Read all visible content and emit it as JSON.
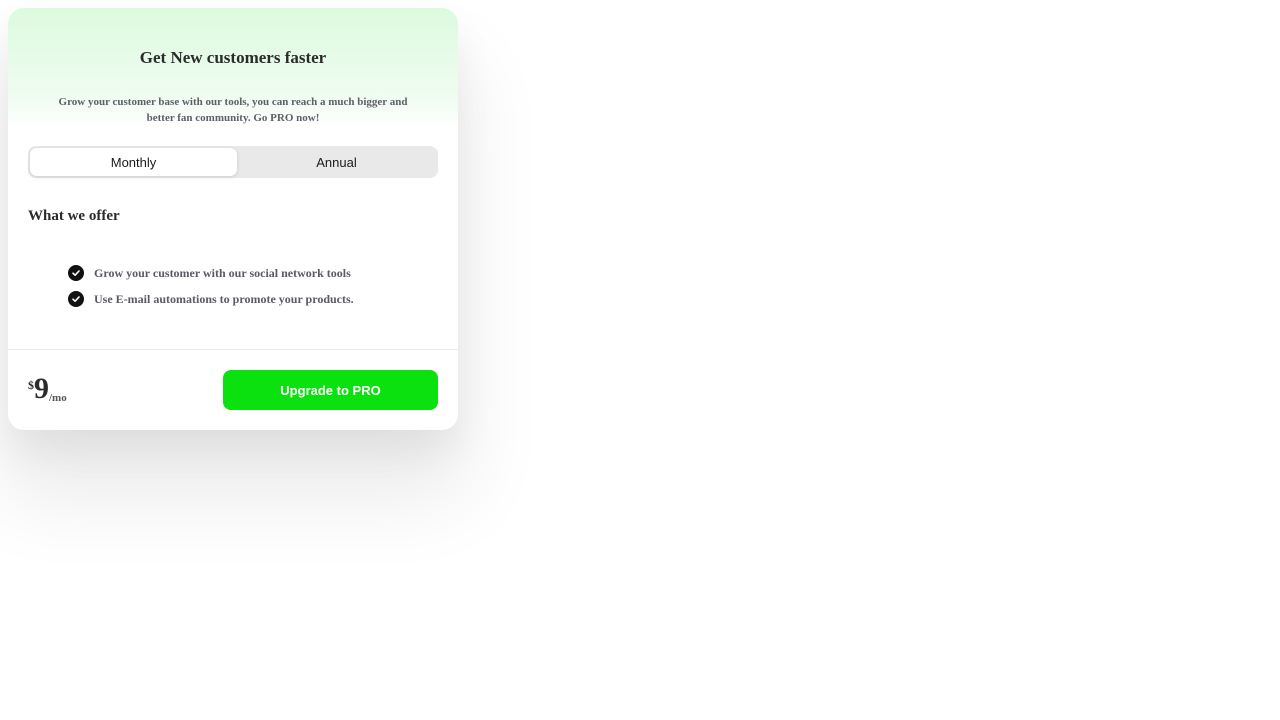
{
  "card": {
    "title": "Get New customers faster",
    "subtitle": "Grow your customer base with our tools, you can reach a much bigger and better fan community. Go PRO now!"
  },
  "billing_toggle": {
    "options": [
      {
        "label": "Monthly",
        "selected": true
      },
      {
        "label": "Annual",
        "selected": false
      }
    ]
  },
  "offer": {
    "title": "What we offer",
    "features": [
      {
        "icon": "check-circle-icon",
        "text": "Grow your customer with our social network tools"
      },
      {
        "icon": "check-circle-icon",
        "text": "Use E-mail automations to promote your products."
      }
    ]
  },
  "pricing": {
    "currency": "$",
    "amount": "9",
    "period": "/mo"
  },
  "cta": {
    "label": "Upgrade to PRO"
  },
  "colors": {
    "accent": "#0be10f",
    "hero_gradient_top": "#dcfadf",
    "text_dark": "#2b2b2b",
    "text_muted": "#5a5a66"
  }
}
